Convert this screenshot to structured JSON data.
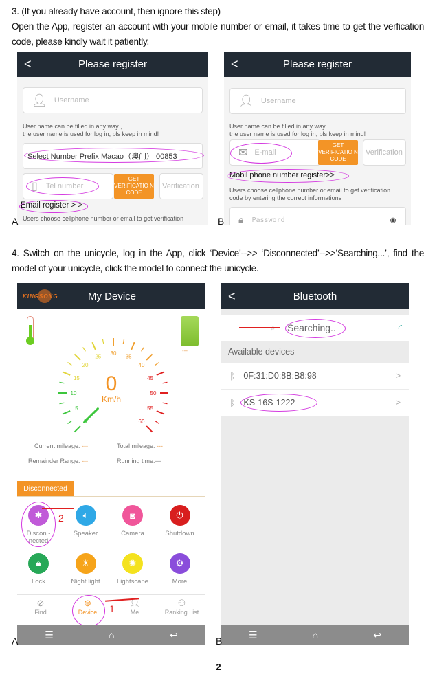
{
  "step3": {
    "title": "3.  (If you already have account, then ignore this step)",
    "body": "Open the App, register an account with your mobile number or email, it takes time to get the verfication code, please kindly wait it patiently."
  },
  "step4": {
    "body": "4.  Switch on the unicycle, log in the App, click ‘Device’-->> ‘Disconnected’-->>’Searching...’, find the model of your unicycle, click the model to connect the unicycle."
  },
  "labels": {
    "a": "A",
    "b": "B"
  },
  "register_a": {
    "title": "Please register",
    "back": "<",
    "username_placeholder": "Username",
    "hint1": "User name can be filled in any way ,",
    "hint2": "the user name is used for log in, pls keep in mind!",
    "prefix": "Select Number Prefix   Macao（澳门） 00853",
    "tel_placeholder": "Tel number",
    "get_code": "GET VERIFICATIO N CODE",
    "verification_placeholder": "Verification",
    "email_register": "Email register > >",
    "hint3": "Users choose cellphone number or email to get verification"
  },
  "register_b": {
    "title": "Please register",
    "back": "<",
    "username_placeholder": "Username",
    "hint1": "User name can be filled in any way ,",
    "hint2": "the user name is used for log in, pls keep in mind!",
    "email_placeholder": "E-mail",
    "get_code": "GET VERIFICATIO N CODE",
    "verification_placeholder": "Verification",
    "mobile_register": "Mobil phone number register>>",
    "hint3": "Users choose cellphone number or email to get verification code by entering the correct informations",
    "password_placeholder": "Password"
  },
  "device": {
    "title": "My Device",
    "logo": "KINGSONG",
    "speed": "0",
    "unit": "Km/h",
    "gauge_labels": [
      "0",
      "5",
      "10",
      "15",
      "20",
      "25",
      "30",
      "35",
      "40",
      "45",
      "50",
      "55",
      "60"
    ],
    "battery": "---",
    "current_mileage": "Current mileage:",
    "current_mileage_value": "---",
    "total_mileage": "Total mileage:",
    "total_mileage_value": "---",
    "remainder_range": "Remainder Range:",
    "remainder_range_value": "---",
    "running_time": "Running time:",
    "running_time_value": "---",
    "status_tab": "Disconnected",
    "grid": [
      {
        "label": "Discon - nected",
        "icon": "bluetooth",
        "color": "#c05ad8"
      },
      {
        "label": "Speaker",
        "icon": "speaker",
        "color": "#2fa8e6"
      },
      {
        "label": "Camera",
        "icon": "camera",
        "color": "#f0569a"
      },
      {
        "label": "Shutdown",
        "icon": "power",
        "color": "#d81e1e"
      },
      {
        "label": "Lock",
        "icon": "lock",
        "color": "#27a857"
      },
      {
        "label": "Night light",
        "icon": "bulb",
        "color": "#f6a41a"
      },
      {
        "label": "Lightscape",
        "icon": "lights",
        "color": "#f4e21e"
      },
      {
        "label": "More",
        "icon": "gear",
        "color": "#8a4ddb"
      }
    ],
    "nav": [
      {
        "label": "Find"
      },
      {
        "label": "Device"
      },
      {
        "label": "Me"
      },
      {
        "label": "Ranking List"
      }
    ],
    "annotations": [
      "2",
      "1"
    ],
    "accent": "#f39426"
  },
  "bluetooth": {
    "title": "Bluetooth",
    "back": "<",
    "searching": "Searching..",
    "available": "Available devices",
    "devices": [
      {
        "name": "0F:31:D0:8B:B8:98"
      },
      {
        "name": "KS-16S-1222"
      }
    ],
    "chevron": ">"
  },
  "page_number": "2"
}
